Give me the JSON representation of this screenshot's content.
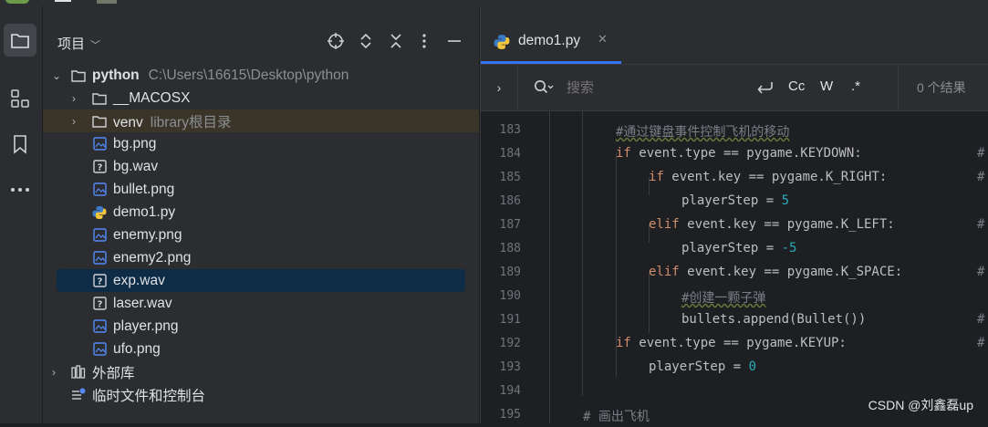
{
  "project": {
    "title": "项目",
    "tree": [
      {
        "label": "python",
        "hint": "C:\\Users\\16615\\Desktop\\python",
        "type": "folder",
        "expanded": true,
        "depth": 0
      },
      {
        "label": "__MACOSX",
        "hint": "",
        "type": "folder",
        "expanded": false,
        "depth": 1
      },
      {
        "label": "venv",
        "hint": "library根目录",
        "type": "folder",
        "expanded": false,
        "depth": 1
      },
      {
        "label": "bg.png",
        "type": "image",
        "depth": 1
      },
      {
        "label": "bg.wav",
        "type": "unknown",
        "depth": 1
      },
      {
        "label": "bullet.png",
        "type": "image",
        "depth": 1
      },
      {
        "label": "demo1.py",
        "type": "python",
        "depth": 1
      },
      {
        "label": "enemy.png",
        "type": "image",
        "depth": 1
      },
      {
        "label": "enemy2.png",
        "type": "image",
        "depth": 1
      },
      {
        "label": "exp.wav",
        "type": "unknown",
        "depth": 1,
        "selected": true
      },
      {
        "label": "laser.wav",
        "type": "unknown",
        "depth": 1
      },
      {
        "label": "player.png",
        "type": "image",
        "depth": 1
      },
      {
        "label": "ufo.png",
        "type": "image",
        "depth": 1
      },
      {
        "label": "外部库",
        "type": "library",
        "expanded": false,
        "depth": 0
      },
      {
        "label": "临时文件和控制台",
        "type": "scratch",
        "depth": 0
      }
    ]
  },
  "editor": {
    "tab_label": "demo1.py",
    "search": {
      "placeholder": "搜索",
      "match_case": "Cc",
      "words": "W",
      "regex": ".*",
      "results": "0 个结果"
    },
    "lines": [
      {
        "num": "183",
        "code": "#通过键盘事件控制飞机的移动"
      },
      {
        "num": "184",
        "code": "if event.type == pygame.KEYDOWN:"
      },
      {
        "num": "185",
        "code": "if event.key == pygame.K_RIGHT:"
      },
      {
        "num": "186",
        "code": "playerStep = 5"
      },
      {
        "num": "187",
        "code": "elif event.key == pygame.K_LEFT:"
      },
      {
        "num": "188",
        "code": "playerStep = -5"
      },
      {
        "num": "189",
        "code": "elif event.key == pygame.K_SPACE:"
      },
      {
        "num": "190",
        "code": "#创建一颗子弹"
      },
      {
        "num": "191",
        "code": "bullets.append(Bullet())"
      },
      {
        "num": "192",
        "code": "if event.type == pygame.KEYUP:"
      },
      {
        "num": "193",
        "code": "playerStep = 0"
      },
      {
        "num": "194",
        "code": ""
      },
      {
        "num": "195",
        "code": "# 画出飞机"
      }
    ],
    "trailing_comment": "#"
  },
  "watermark": "CSDN @刘鑫磊up",
  "colors": {
    "keyword": "#cf8e6d",
    "number": "#2aacb8",
    "comment": "#7a7e85",
    "accent": "#3574f0",
    "selection": "#0e2c45"
  }
}
